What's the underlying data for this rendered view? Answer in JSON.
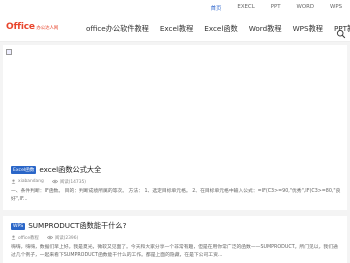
{
  "topnav": {
    "items": [
      "首页",
      "EXECL",
      "PPT",
      "WORD",
      "WPS"
    ],
    "active_index": 0
  },
  "brand": {
    "main": "Office",
    "sub": "办公达人网"
  },
  "mainnav": {
    "items": [
      "office办公软件教程",
      "Excel教程",
      "Excel函数",
      "Word教程",
      "WPS教程",
      "PPT教程"
    ]
  },
  "icons": {
    "search": "search-icon",
    "author": "user-icon",
    "views": "eye-icon",
    "broken": "broken-image-icon"
  },
  "colors": {
    "brand": "#e8452c",
    "accent": "#2a66c8",
    "active_nav": "#3b6fd0"
  },
  "articles": [
    {
      "tag": "Excel函数",
      "title": "excel函数公式大全",
      "author": "xiabandang",
      "views": "阅读(14735)",
      "excerpt": "一、条件判断：IF函数。 目的：判断成绩所属的等次。 方法： 1、选定目标单元格。 2、在目标单元格中输入公式：=IF(C3>=90,\"优秀\",IF(C3>=80,\"良好\",IF..."
    },
    {
      "tag": "WPS",
      "title": "SUMPRODUCT函数能干什么?",
      "author": "office教程",
      "views": "阅读(2396)",
      "excerpt": "嗨嗨，嗨嗨，数据们早上好。我是夏光，微软又见面了。今天和大家分享一个非常有趣，但是在用你常广泛的函数——SUMPRODUCT。所门见以，我们通过几个例子，一起来看下SUMPRODUCT函数能干什么的工作。都是上面的隐藏，在是下公司工资..."
    }
  ]
}
